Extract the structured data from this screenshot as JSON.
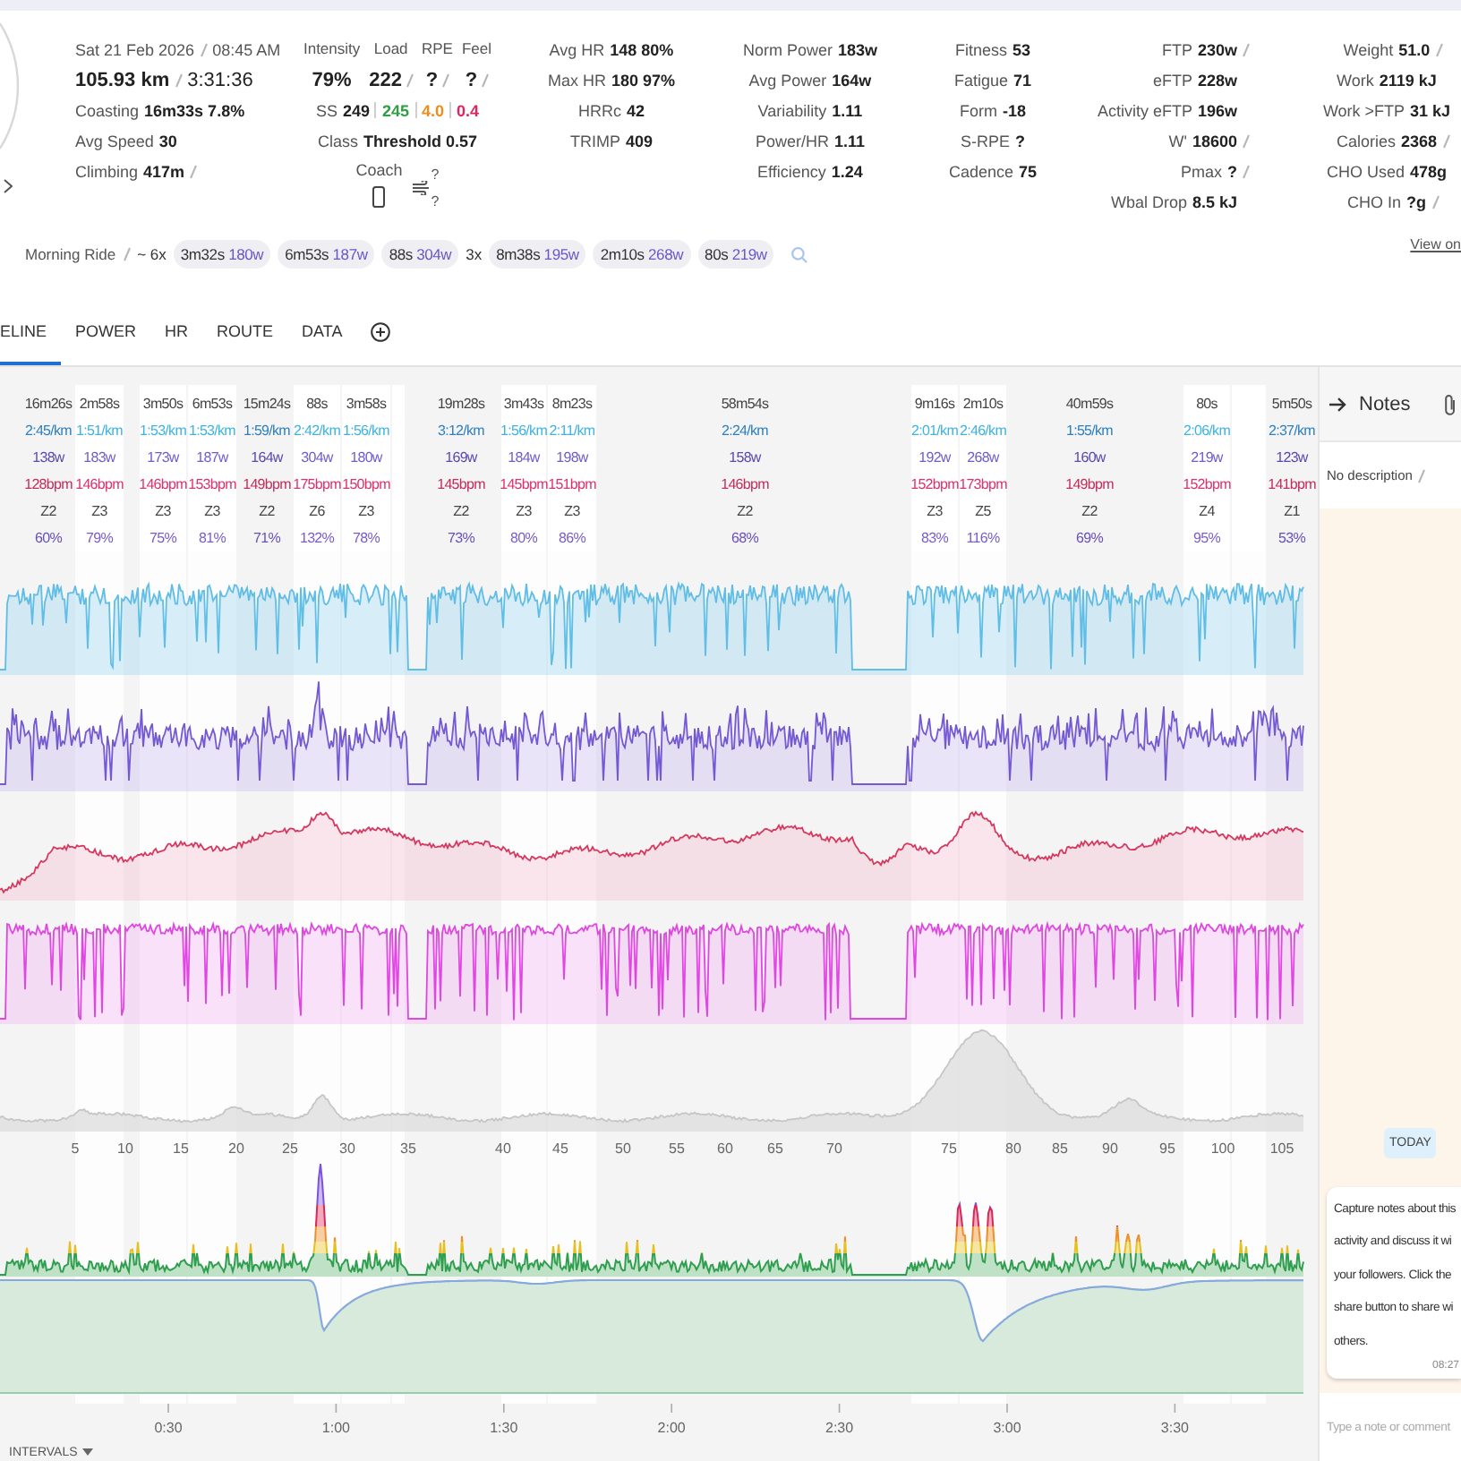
{
  "summary": {
    "date": "Sat 21 Feb 2026",
    "date_editable": true,
    "time": "08:45 AM",
    "distance": "105.93 km",
    "distance_editable": true,
    "duration": "3:31:36",
    "stats": [
      {
        "label": "Coasting",
        "value": "16m33s 7.8%",
        "editable": false
      },
      {
        "label": "Avg Speed",
        "value": "30",
        "editable": false
      },
      {
        "label": "Climbing",
        "value": "417m",
        "editable": true
      }
    ]
  },
  "load": {
    "columns": [
      {
        "label": "Intensity",
        "value": "79%",
        "editable": false
      },
      {
        "label": "Load",
        "value": "222",
        "editable": true
      },
      {
        "label": "RPE",
        "value": "?",
        "editable": true
      },
      {
        "label": "Feel",
        "value": "?",
        "editable": true
      }
    ],
    "ss": {
      "label": "SS",
      "values": [
        {
          "text": "249",
          "color": "#222222"
        },
        {
          "text": "245",
          "color": "#2f9e44"
        },
        {
          "text": "4.0",
          "color": "#f08c1a"
        },
        {
          "text": "0.4",
          "color": "#e0245e"
        }
      ]
    },
    "class": {
      "label": "Class",
      "value": "Threshold 0.57"
    },
    "coach_label": "Coach",
    "wind_marks": [
      "?",
      "?"
    ]
  },
  "stat_groups": [
    [
      {
        "label": "Avg HR",
        "value": "148 80%",
        "editable": false
      },
      {
        "label": "Max HR",
        "value": "180 97%",
        "editable": false
      },
      {
        "label": "HRRc",
        "value": "42",
        "editable": false
      },
      {
        "label": "TRIMP",
        "value": "409",
        "editable": false
      }
    ],
    [
      {
        "label": "Norm Power",
        "value": "183w",
        "editable": false
      },
      {
        "label": "Avg Power",
        "value": "164w",
        "editable": false
      },
      {
        "label": "Variability",
        "value": "1.11",
        "editable": false
      },
      {
        "label": "Power/HR",
        "value": "1.11",
        "editable": false
      },
      {
        "label": "Efficiency",
        "value": "1.24",
        "editable": false
      }
    ],
    [
      {
        "label": "Fitness",
        "value": "53",
        "editable": false
      },
      {
        "label": "Fatigue",
        "value": "71",
        "editable": false
      },
      {
        "label": "Form",
        "value": "-18",
        "editable": false
      },
      {
        "label": "S-RPE",
        "value": "?",
        "editable": false
      },
      {
        "label": "Cadence",
        "value": "75",
        "editable": false
      }
    ],
    [
      {
        "label": "FTP",
        "value": "230w",
        "editable": true
      },
      {
        "label": "eFTP",
        "value": "228w",
        "editable": false
      },
      {
        "label": "Activity eFTP",
        "value": "196w",
        "editable": false
      },
      {
        "label": "W'",
        "value": "18600",
        "editable": true
      },
      {
        "label": "Pmax",
        "value": "?",
        "editable": true
      },
      {
        "label": "Wbal Drop",
        "value": "8.5 kJ",
        "editable": false
      }
    ],
    [
      {
        "label": "Weight",
        "value": "51.0",
        "editable": true
      },
      {
        "label": "Work",
        "value": "2119 kJ",
        "editable": false
      },
      {
        "label": "Work >FTP",
        "value": "31 kJ",
        "editable": false
      },
      {
        "label": "Calories",
        "value": "2368",
        "editable": true
      },
      {
        "label": "CHO Used",
        "value": "478g",
        "editable": false
      },
      {
        "label": "CHO In",
        "value": "?g",
        "editable": true
      }
    ]
  ],
  "title_row": {
    "title": "Morning Ride",
    "title_editable": true,
    "parts": [
      {
        "kind": "text",
        "text": "~ 6x"
      },
      {
        "kind": "chip",
        "duration": "3m32s",
        "power": "180w"
      },
      {
        "kind": "chip",
        "duration": "6m53s",
        "power": "187w"
      },
      {
        "kind": "chip",
        "duration": "88s",
        "power": "304w"
      },
      {
        "kind": "text",
        "text": "3x"
      },
      {
        "kind": "chip",
        "duration": "8m38s",
        "power": "195w"
      },
      {
        "kind": "chip",
        "duration": "2m10s",
        "power": "268w"
      },
      {
        "kind": "chip",
        "duration": "80s",
        "power": "219w"
      }
    ]
  },
  "view_link": "View on",
  "tabs": [
    {
      "label": "ELINE",
      "selected": true
    },
    {
      "label": "POWER",
      "selected": false
    },
    {
      "label": "HR",
      "selected": false
    },
    {
      "label": "ROUTE",
      "selected": false
    },
    {
      "label": "DATA",
      "selected": false
    }
  ],
  "intervals": [
    {
      "kind": "rest",
      "duration": "16m26s",
      "pace": "2:45/km",
      "power": "138w",
      "heart_rate": "128bpm",
      "zone": "Z2",
      "percent": "60%"
    },
    {
      "kind": "work",
      "duration": "2m58s",
      "pace": "1:51/km",
      "power": "183w",
      "heart_rate": "146bpm",
      "zone": "Z3",
      "percent": "79%"
    },
    {
      "kind": "work",
      "duration": "3m50s",
      "pace": "1:53/km",
      "power": "173w",
      "heart_rate": "146bpm",
      "zone": "Z3",
      "percent": "75%"
    },
    {
      "kind": "work",
      "duration": "6m53s",
      "pace": "1:53/km",
      "power": "187w",
      "heart_rate": "153bpm",
      "zone": "Z3",
      "percent": "81%"
    },
    {
      "kind": "rest",
      "duration": "15m24s",
      "pace": "1:59/km",
      "power": "164w",
      "heart_rate": "149bpm",
      "zone": "Z2",
      "percent": "71%"
    },
    {
      "kind": "work",
      "duration": "88s",
      "pace": "2:42/km",
      "power": "304w",
      "heart_rate": "175bpm",
      "zone": "Z6",
      "percent": "132%"
    },
    {
      "kind": "work",
      "duration": "3m58s",
      "pace": "1:56/km",
      "power": "180w",
      "heart_rate": "150bpm",
      "zone": "Z3",
      "percent": "78%"
    },
    {
      "kind": "work"
    },
    {
      "kind": "rest",
      "duration": "19m28s",
      "pace": "3:12/km",
      "power": "169w",
      "heart_rate": "145bpm",
      "zone": "Z2",
      "percent": "73%"
    },
    {
      "kind": "work",
      "duration": "3m43s",
      "pace": "1:56/km",
      "power": "184w",
      "heart_rate": "145bpm",
      "zone": "Z3",
      "percent": "80%"
    },
    {
      "kind": "work",
      "duration": "8m23s",
      "pace": "2:11/km",
      "power": "198w",
      "heart_rate": "151bpm",
      "zone": "Z3",
      "percent": "86%"
    },
    {
      "kind": "rest",
      "duration": "58m54s",
      "pace": "2:24/km",
      "power": "158w",
      "heart_rate": "146bpm",
      "zone": "Z2",
      "percent": "68%"
    },
    {
      "kind": "work",
      "duration": "9m16s",
      "pace": "2:01/km",
      "power": "192w",
      "heart_rate": "152bpm",
      "zone": "Z3",
      "percent": "83%"
    },
    {
      "kind": "work",
      "duration": "2m10s",
      "pace": "2:46/km",
      "power": "268w",
      "heart_rate": "173bpm",
      "zone": "Z5",
      "percent": "116%"
    },
    {
      "kind": "rest",
      "duration": "40m59s",
      "pace": "1:55/km",
      "power": "160w",
      "heart_rate": "149bpm",
      "zone": "Z2",
      "percent": "69%"
    },
    {
      "kind": "work",
      "duration": "80s",
      "pace": "2:06/km",
      "power": "219w",
      "heart_rate": "152bpm",
      "zone": "Z4",
      "percent": "95%"
    },
    {
      "kind": "work"
    },
    {
      "kind": "rest",
      "duration": "5m50s",
      "pace": "2:37/km",
      "power": "123w",
      "heart_rate": "141bpm",
      "zone": "Z1",
      "percent": "53%"
    }
  ],
  "chart_labels": {
    "distance": [
      "5",
      "10",
      "15",
      "20",
      "25",
      "30",
      "35",
      "40",
      "45",
      "50",
      "55",
      "60",
      "65",
      "70",
      "75",
      "80",
      "85",
      "90",
      "95",
      "100",
      "105"
    ],
    "time": [
      "0:30",
      "1:00",
      "1:30",
      "2:00",
      "2:30",
      "3:00",
      "3:30"
    ]
  },
  "intervals_label": "INTERVALS",
  "notes": {
    "title": "Notes",
    "description": "No description",
    "description_editable": true,
    "day_badge": "TODAY",
    "messages": [
      {
        "lines": [
          "Capture notes about this",
          "activity and discuss it wi",
          "your followers. Click the",
          "share button to share wi",
          "others."
        ],
        "time": "08:27"
      }
    ],
    "input": {
      "placeholder": "Type a note or comment"
    }
  }
}
